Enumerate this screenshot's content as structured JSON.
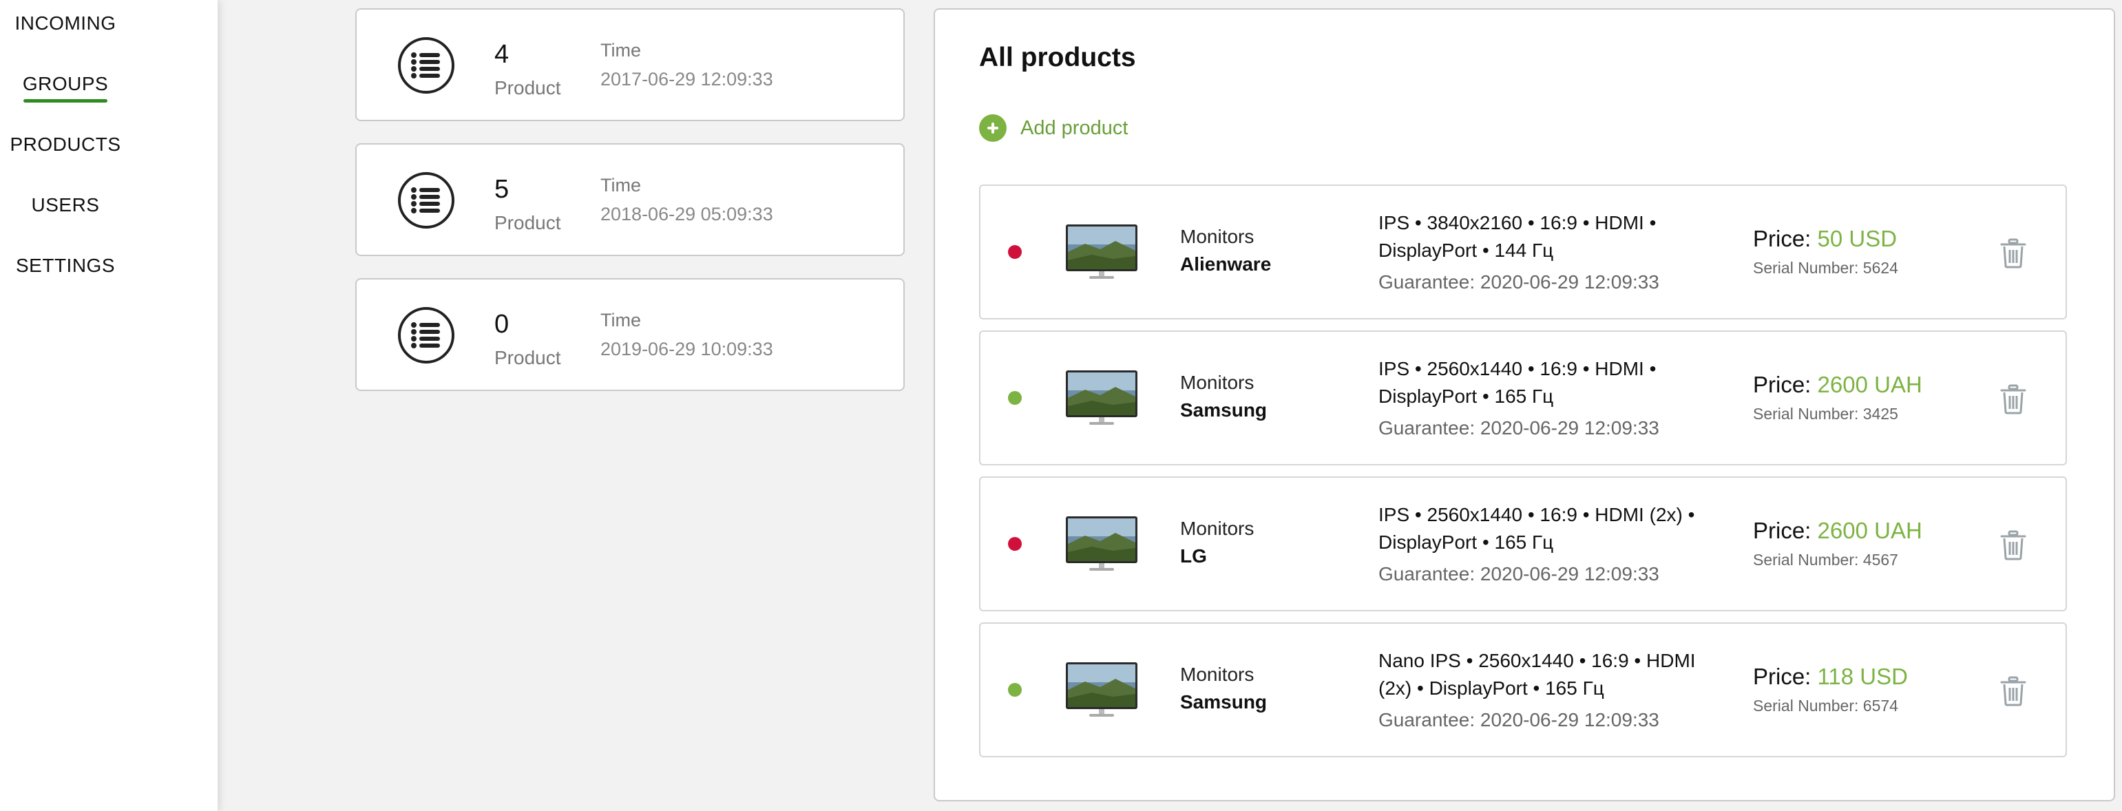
{
  "nav": {
    "items": [
      {
        "label": "INCOMING"
      },
      {
        "label": "GROUPS"
      },
      {
        "label": "PRODUCTS"
      },
      {
        "label": "USERS"
      },
      {
        "label": "SETTINGS"
      }
    ],
    "active": "GROUPS"
  },
  "groups": [
    {
      "count": "4",
      "unit": "Product",
      "time_label": "Time",
      "time": "2017-06-29 12:09:33",
      "icon": "list-icon"
    },
    {
      "count": "5",
      "unit": "Product",
      "time_label": "Time",
      "time": "2018-06-29 05:09:33",
      "icon": "list-icon"
    },
    {
      "count": "0",
      "unit": "Product",
      "time_label": "Time",
      "time": "2019-06-29 10:09:33",
      "icon": "list-icon"
    }
  ],
  "panel": {
    "title": "All products",
    "add_label": "Add product"
  },
  "products": [
    {
      "status_color": "#d0103a",
      "category": "Monitors",
      "brand": "Alienware",
      "specs": "IPS • 3840x2160 • 16:9 • HDMI • DisplayPort • 144 Гц",
      "guarantee": "Guarantee: 2020-06-29 12:09:33",
      "price_label": "Price:",
      "price": "50 USD",
      "serial": "Serial Number: 5624"
    },
    {
      "status_color": "#7cb342",
      "category": "Monitors",
      "brand": "Samsung",
      "specs": "IPS • 2560x1440 • 16:9 • HDMI • DisplayPort • 165 Гц",
      "guarantee": "Guarantee: 2020-06-29 12:09:33",
      "price_label": "Price:",
      "price": "2600 UAH",
      "serial": "Serial Number: 3425"
    },
    {
      "status_color": "#d0103a",
      "category": "Monitors",
      "brand": "LG",
      "specs": "IPS • 2560x1440 • 16:9 • HDMI (2x) • DisplayPort • 165 Гц",
      "guarantee": "Guarantee: 2020-06-29 12:09:33",
      "price_label": "Price:",
      "price": "2600 UAH",
      "serial": "Serial Number: 4567"
    },
    {
      "status_color": "#7cb342",
      "category": "Monitors",
      "brand": "Samsung",
      "specs": "Nano IPS • 2560x1440 • 16:9 • HDMI (2x) • DisplayPort • 165 Гц",
      "guarantee": "Guarantee: 2020-06-29 12:09:33",
      "price_label": "Price:",
      "price": "118 USD",
      "serial": "Serial Number: 6574"
    }
  ],
  "colors": {
    "accent_green": "#7cb342",
    "nav_underline": "#2e8b1f",
    "status_red": "#d0103a"
  }
}
